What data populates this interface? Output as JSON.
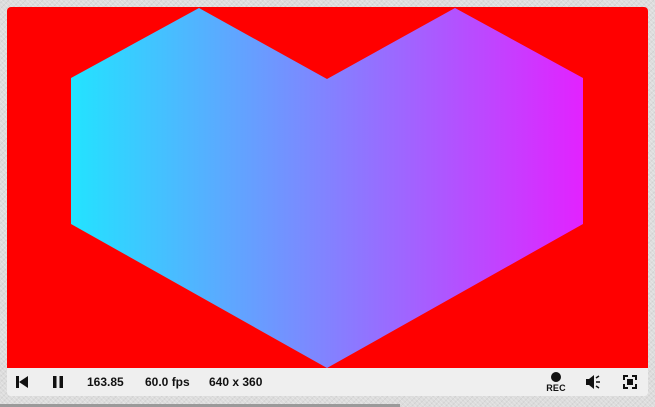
{
  "canvas": {
    "background_color": "#ff0000",
    "shape": "heart-hexagon",
    "gradient_start_color": "#22e3ff",
    "gradient_end_color": "#e222ff"
  },
  "controls": {
    "rewind_icon": "skip-to-start-icon",
    "pause_icon": "pause-icon",
    "time": "163.85",
    "fps": "60.0 fps",
    "resolution": "640 x 360",
    "rec_icon": "record-dot-icon",
    "rec_label": "REC",
    "volume_icon": "volume-icon",
    "fullscreen_icon": "fullscreen-icon"
  }
}
